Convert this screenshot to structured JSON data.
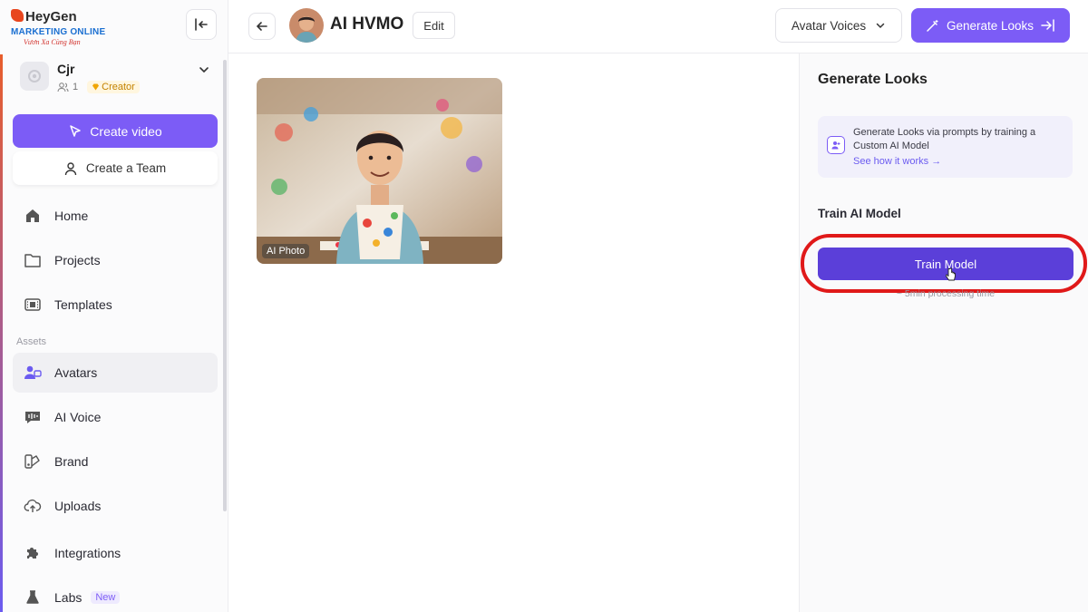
{
  "logo": {
    "brand": "HeyGen",
    "sub1": "MARKETING ONLINE",
    "sub2": "Vươn Xa Cùng Bạn"
  },
  "sidebar": {
    "workspace": {
      "name": "Cjr",
      "members": "1",
      "plan": "Creator"
    },
    "create_video": "Create video",
    "create_team": "Create a Team",
    "items": [
      {
        "label": "Home",
        "icon": "home-icon"
      },
      {
        "label": "Projects",
        "icon": "folder-icon"
      },
      {
        "label": "Templates",
        "icon": "film-icon"
      }
    ],
    "assets_label": "Assets",
    "asset_items": [
      {
        "label": "Avatars",
        "icon": "avatar-icon",
        "active": true
      },
      {
        "label": "AI Voice",
        "icon": "voice-icon"
      },
      {
        "label": "Brand",
        "icon": "brand-icon"
      },
      {
        "label": "Uploads",
        "icon": "upload-icon"
      },
      {
        "label": "Integrations",
        "icon": "puzzle-icon"
      },
      {
        "label": "Labs",
        "icon": "flask-icon",
        "badge": "New"
      }
    ]
  },
  "header": {
    "title": "AI HVMO",
    "edit": "Edit",
    "voices": "Avatar Voices",
    "generate": "Generate Looks"
  },
  "main": {
    "photo_tag": "AI Photo"
  },
  "panel": {
    "title": "Generate Looks",
    "info_text": "Generate Looks via prompts by training a Custom AI Model",
    "info_link": "See how it works →",
    "train_label": "Train AI Model",
    "train_button": "Train Model",
    "processing": "~ 5min processing time"
  },
  "colors": {
    "accent": "#7c5cf6",
    "train_button": "#5b3fd9",
    "highlight": "#e01919"
  }
}
